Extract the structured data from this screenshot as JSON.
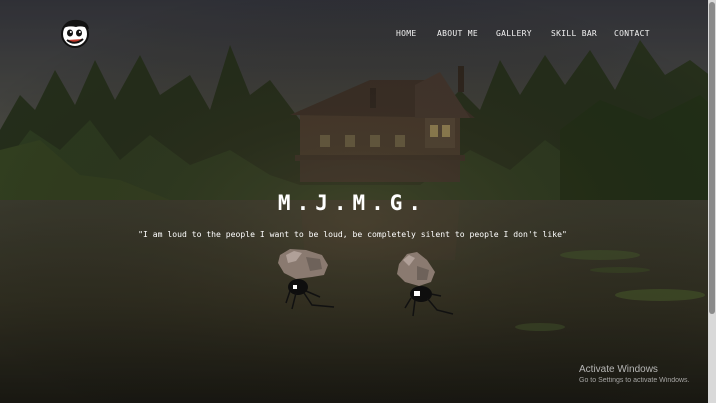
{
  "nav": {
    "items": [
      {
        "label": "HOME"
      },
      {
        "label": "ABOUT ME"
      },
      {
        "label": "GALLERY"
      },
      {
        "label": "SKILL BAR"
      },
      {
        "label": "CONTACT"
      }
    ]
  },
  "hero": {
    "title": "M.J.M.G.",
    "quote": "\"I am loud to the people I want to be loud, be completely silent to people I don't like\""
  },
  "watermark": {
    "title": "Activate Windows",
    "subtitle": "Go to Settings to activate Windows."
  },
  "colors": {
    "nav_text": "#f2f2f2",
    "hero_text": "#ffffff",
    "scrollbar_track": "#d9d9d9",
    "scrollbar_thumb": "#8a8a8a"
  },
  "icons": {
    "logo": "cartoon-face-logo",
    "critters": [
      "rock-hermit-critter",
      "rock-hermit-critter"
    ]
  }
}
